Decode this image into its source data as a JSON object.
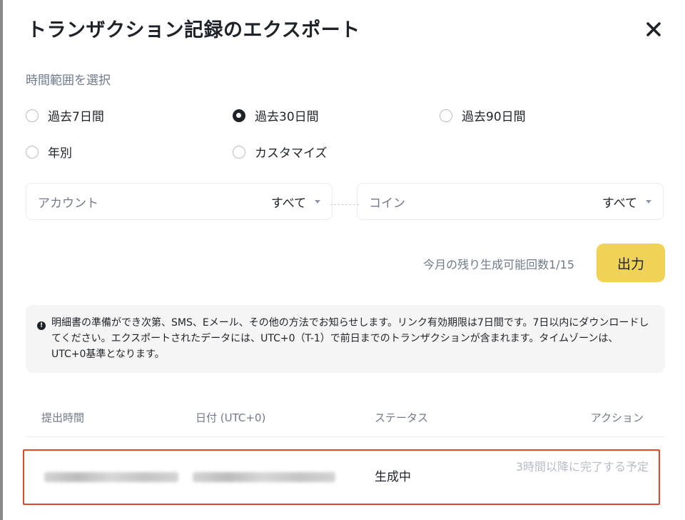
{
  "modal": {
    "title": "トランザクション記録のエクスポート"
  },
  "time_range": {
    "label": "時間範囲を選択",
    "options": [
      {
        "label": "過去7日間",
        "checked": false
      },
      {
        "label": "過去30日間",
        "checked": true
      },
      {
        "label": "過去90日間",
        "checked": false
      },
      {
        "label": "年別",
        "checked": false
      },
      {
        "label": "カスタマイズ",
        "checked": false
      }
    ]
  },
  "filters": {
    "account": {
      "placeholder": "アカウント",
      "value": "すべて"
    },
    "coin": {
      "placeholder": "コイン",
      "value": "すべて"
    }
  },
  "export": {
    "remaining_text": "今月の残り生成可能回数1/15",
    "button_label": "出力"
  },
  "notice": {
    "text": "明細書の準備ができ次第、SMS、Eメール、その他の方法でお知らせします。リンク有効期限は7日間です。7日以内にダウンロードしてください。エクスポートされたデータには、UTC+0（T-1）で前日までのトランザクションが含まれます。タイムゾーンは、UTC+0基準となります。"
  },
  "table": {
    "headers": [
      "提出時間",
      "日付 (UTC+0)",
      "ステータス",
      "アクション"
    ],
    "rows": [
      {
        "status": "生成中",
        "action": "3時間以降に完了する予定"
      }
    ]
  },
  "icons": {
    "close": "close-icon",
    "info": "info-icon"
  }
}
